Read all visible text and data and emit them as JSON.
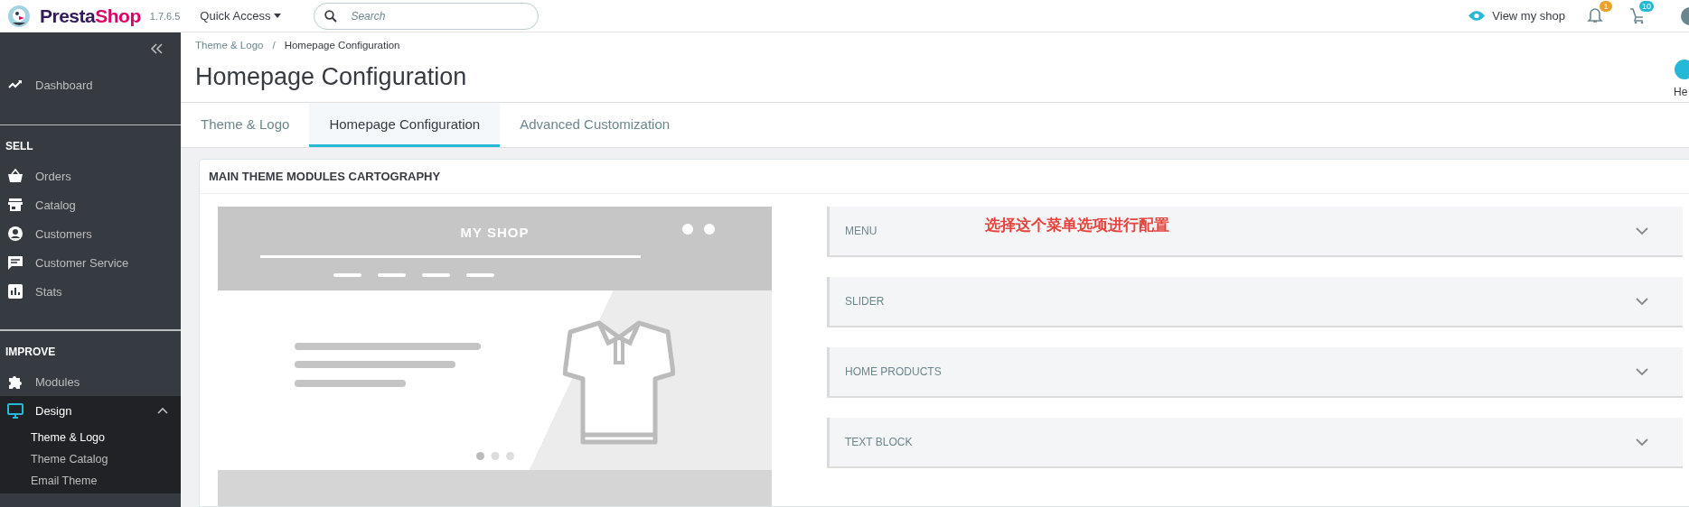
{
  "topbar": {
    "logo_parts": [
      "Presta",
      "Shop"
    ],
    "version": "1.7.6.5",
    "quick_access": "Quick Access",
    "search": {
      "placeholder": "Search"
    },
    "view_shop": "View my shop",
    "notifications": [
      {
        "kind": "bell",
        "count": "1",
        "color": "#f0a02a"
      },
      {
        "kind": "cart",
        "count": "10",
        "color": "#25b9d7"
      }
    ]
  },
  "sidebar": {
    "sections": [
      {
        "items": [
          {
            "label": "Dashboard",
            "selected": false
          }
        ]
      },
      {
        "title": "SELL",
        "items": [
          {
            "label": "Orders",
            "selected": false
          },
          {
            "label": "Catalog",
            "selected": false
          },
          {
            "label": "Customers",
            "selected": false
          },
          {
            "label": "Customer Service",
            "selected": false
          },
          {
            "label": "Stats",
            "selected": false
          }
        ]
      },
      {
        "title": "IMPROVE",
        "items": [
          {
            "label": "Modules",
            "selected": false
          },
          {
            "label": "Design",
            "selected": true,
            "expanded": true,
            "children": [
              {
                "label": "Theme & Logo",
                "selected": true
              },
              {
                "label": "Theme Catalog",
                "selected": false
              },
              {
                "label": "Email Theme",
                "selected": false
              }
            ]
          }
        ]
      }
    ]
  },
  "header": {
    "breadcrumb": [
      "Theme & Logo",
      "Homepage Configuration"
    ],
    "separator": "/",
    "title": "Homepage Configuration",
    "help": "He"
  },
  "tabs": [
    {
      "label": "Theme & Logo",
      "selected": false
    },
    {
      "label": "Homepage Configuration",
      "selected": true
    },
    {
      "label": "Advanced Customization",
      "selected": false
    }
  ],
  "card": {
    "title": "MAIN THEME MODULES CARTOGRAPHY",
    "preview": {
      "shop_name": "MY SHOP"
    },
    "panels": [
      {
        "title": "MENU",
        "expanded": false
      },
      {
        "title": "SLIDER",
        "expanded": false
      },
      {
        "title": "HOME PRODUCTS",
        "expanded": false
      },
      {
        "title": "TEXT BLOCK",
        "expanded": false
      }
    ],
    "annotation": "选择这个菜单选项进行配置"
  }
}
